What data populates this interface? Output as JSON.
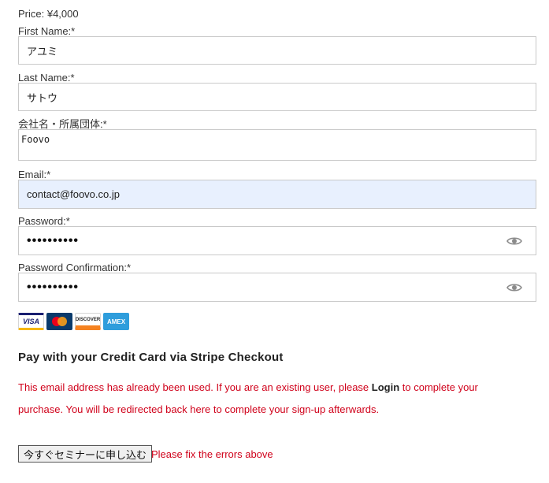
{
  "price_text": "Price: ¥4,000",
  "fields": {
    "first_name": {
      "label": "First Name:*",
      "value": "アユミ"
    },
    "last_name": {
      "label": "Last Name:*",
      "value": "サトウ"
    },
    "company": {
      "label": "会社名・所属団体:*",
      "value": "Foovo"
    },
    "email": {
      "label": "Email:*",
      "value": "contact@foovo.co.jp"
    },
    "password": {
      "label": "Password:*",
      "value": "••••••••••"
    },
    "password_confirm": {
      "label": "Password Confirmation:*",
      "value": "••••••••••"
    }
  },
  "cards": {
    "visa": "VISA",
    "discover": "DISCOVER",
    "amex": "AMEX"
  },
  "payment_heading": "Pay with your Credit Card via Stripe Checkout",
  "error_message": {
    "before": "This email address has already been used. If you are an existing user, please ",
    "link": "Login",
    "after": " to complete your purchase. You will be redirected back here to complete your sign-up afterwards."
  },
  "submit_label": "今すぐセミナーに申し込む",
  "submit_error": "Please fix the errors above",
  "colors": {
    "error": "#d0021b",
    "autofill_bg": "#e8f0fe",
    "border": "#c9c9c9"
  },
  "icons": [
    "eye-icon",
    "visa-card-icon",
    "mastercard-icon",
    "discover-card-icon",
    "amex-card-icon"
  ]
}
